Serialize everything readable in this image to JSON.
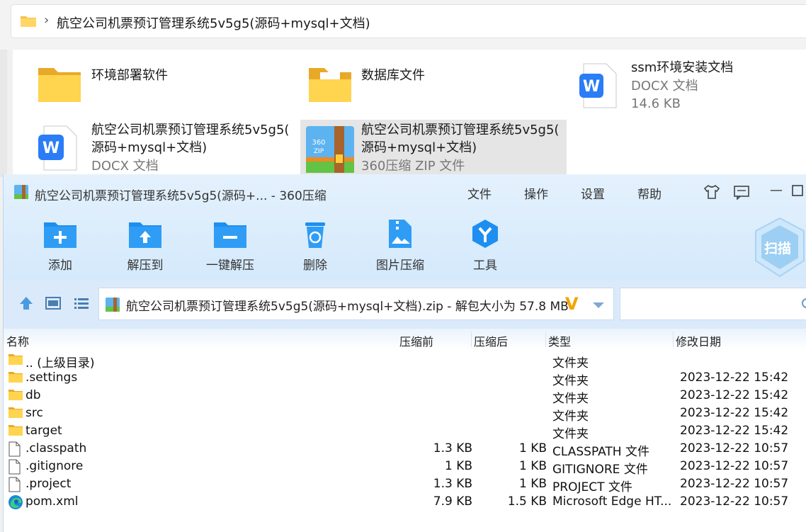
{
  "explorer": {
    "breadcrumb_chevron": "›",
    "path": "航空公司机票预订管理系统5v5g5(源码+mysql+文档)",
    "tiles": [
      {
        "name": "环境部署软件",
        "sub1": "",
        "sub2": "",
        "icon": "folder-icon"
      },
      {
        "name": "数据库文件",
        "sub1": "",
        "sub2": "",
        "icon": "folder-with-files-icon"
      },
      {
        "name": "ssm环境安装文档",
        "sub1": "DOCX 文档",
        "sub2": "14.6 KB",
        "icon": "wps-doc-icon"
      },
      {
        "name_line1": "航空公司机票预订管理系统5v5g5(",
        "name_line2": "源码+mysql+文档)",
        "sub1": "DOCX 文档",
        "icon": "wps-doc-icon"
      },
      {
        "name_line1": "航空公司机票预订管理系统5v5g5(",
        "name_line2": "源码+mysql+文档)",
        "sub1": "360压缩 ZIP 文件",
        "icon": "zip-archive-icon"
      }
    ]
  },
  "zip": {
    "title": "航空公司机票预订管理系统5v5g5(源码+... - 360压缩",
    "menu": [
      "文件",
      "操作",
      "设置",
      "帮助"
    ],
    "window_controls": {
      "minimize": "—"
    },
    "tools": [
      {
        "label": "添加",
        "icon": "add-icon"
      },
      {
        "label": "解压到",
        "icon": "extract-to-icon"
      },
      {
        "label": "一键解压",
        "icon": "one-click-extract-icon"
      },
      {
        "label": "删除",
        "icon": "delete-icon"
      },
      {
        "label": "图片压缩",
        "icon": "image-compress-icon"
      },
      {
        "label": "工具",
        "icon": "tools-icon"
      }
    ],
    "scan_label": "扫描",
    "path_text": "航空公司机票预订管理系统5v5g5(源码+mysql+文档).zip - 解包大小为 57.8 MB",
    "v_badge": "V",
    "search_placeholder": "",
    "columns": {
      "name": "名称",
      "size": "压缩前",
      "packed": "压缩后",
      "type": "类型",
      "date": "修改日期"
    },
    "rows": [
      {
        "name": ".. (上级目录)",
        "size": "",
        "packed": "",
        "type": "文件夹",
        "date": "",
        "icon": "folder"
      },
      {
        "name": ".settings",
        "size": "",
        "packed": "",
        "type": "文件夹",
        "date": "2023-12-22 15:42",
        "icon": "folder"
      },
      {
        "name": "db",
        "size": "",
        "packed": "",
        "type": "文件夹",
        "date": "2023-12-22 15:42",
        "icon": "folder"
      },
      {
        "name": "src",
        "size": "",
        "packed": "",
        "type": "文件夹",
        "date": "2023-12-22 15:42",
        "icon": "folder"
      },
      {
        "name": "target",
        "size": "",
        "packed": "",
        "type": "文件夹",
        "date": "2023-12-22 15:42",
        "icon": "folder"
      },
      {
        "name": ".classpath",
        "size": "1.3 KB",
        "packed": "1 KB",
        "type": "CLASSPATH 文件",
        "date": "2023-12-22 10:57",
        "icon": "file"
      },
      {
        "name": ".gitignore",
        "size": "1 KB",
        "packed": "1 KB",
        "type": "GITIGNORE 文件",
        "date": "2023-12-22 10:57",
        "icon": "file"
      },
      {
        "name": ".project",
        "size": "1.3 KB",
        "packed": "1 KB",
        "type": "PROJECT 文件",
        "date": "2023-12-22 10:57",
        "icon": "file"
      },
      {
        "name": "pom.xml",
        "size": "7.9 KB",
        "packed": "1.5 KB",
        "type": "Microsoft Edge HT...",
        "date": "2023-12-22 10:57",
        "icon": "edge"
      }
    ]
  }
}
